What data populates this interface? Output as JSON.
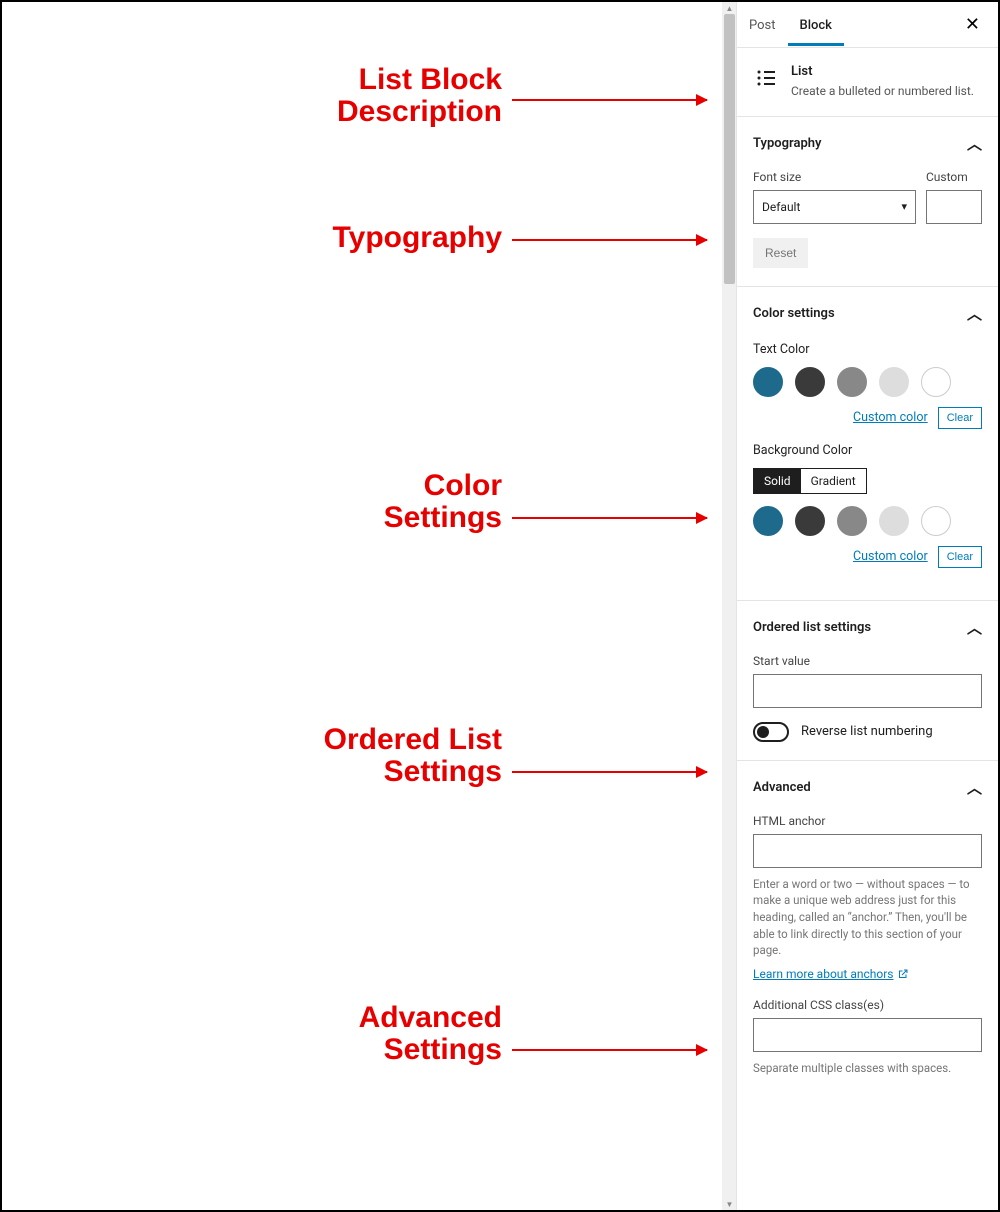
{
  "annotations": {
    "a1_l1": "List Block",
    "a1_l2": "Description",
    "a2": "Typography",
    "a3_l1": "Color",
    "a3_l2": "Settings",
    "a4_l1": "Ordered List",
    "a4_l2": "Settings",
    "a5_l1": "Advanced",
    "a5_l2": "Settings"
  },
  "tabs": {
    "post": "Post",
    "block": "Block"
  },
  "block": {
    "title": "List",
    "caption": "Create a bulleted or numbered list."
  },
  "typography": {
    "title": "Typography",
    "font_size_label": "Font size",
    "custom_label": "Custom",
    "select_value": "Default",
    "reset": "Reset"
  },
  "color": {
    "title": "Color settings",
    "text_color_label": "Text Color",
    "bg_label": "Background Color",
    "solid": "Solid",
    "gradient": "Gradient",
    "custom_color": "Custom color",
    "clear": "Clear"
  },
  "ordered": {
    "title": "Ordered list settings",
    "start_label": "Start value",
    "reverse_label": "Reverse list numbering"
  },
  "advanced": {
    "title": "Advanced",
    "anchor_label": "HTML anchor",
    "anchor_help": "Enter a word or two — without spaces — to make a unique web address just for this heading, called an “anchor.” Then, you'll be able to link directly to this section of your page.",
    "learn_more": "Learn more about anchors",
    "css_label": "Additional CSS class(es)",
    "css_help": "Separate multiple classes with spaces."
  }
}
